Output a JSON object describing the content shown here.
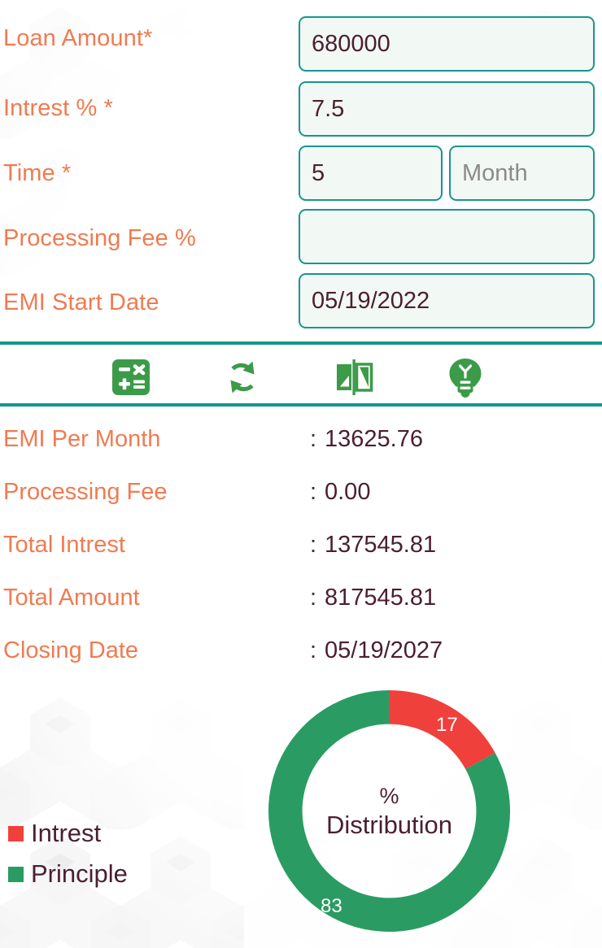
{
  "theme": {
    "label_color": "#ef7b52",
    "value_color": "#4a1f32",
    "accent_teal": "#17968f",
    "icon_green": "#3c9b49",
    "interest_red": "#f0403c",
    "principle_green": "#2a9c63",
    "field_bg": "#f2f8f4",
    "page_bg": "#ffffff"
  },
  "form": {
    "rows": [
      {
        "label": "Loan Amount*",
        "value": "680000",
        "placeholder": "",
        "name": "loan-amount"
      },
      {
        "label": "Intrest % *",
        "value": "7.5",
        "placeholder": "",
        "name": "interest-rate"
      },
      {
        "label": "Time *",
        "value": "5",
        "placeholder": "",
        "name": "time",
        "unit_value": "",
        "unit_placeholder": "Month"
      },
      {
        "label": "Processing Fee %",
        "value": "",
        "placeholder": "",
        "name": "processing-fee"
      },
      {
        "label": "EMI Start Date",
        "value": "05/19/2022",
        "placeholder": "",
        "name": "emi-start-date"
      }
    ]
  },
  "toolbar": {
    "buttons": [
      {
        "name": "calculate-button",
        "icon": "calculator-icon",
        "label": "Calculate"
      },
      {
        "name": "reset-button",
        "icon": "refresh-icon",
        "label": "Reset"
      },
      {
        "name": "compare-button",
        "icon": "compare-flip-icon",
        "label": "Compare"
      },
      {
        "name": "tips-button",
        "icon": "lightbulb-icon",
        "label": "Tips"
      }
    ]
  },
  "results": {
    "separator": ":",
    "rows": [
      {
        "label": "EMI Per Month",
        "value": "13625.76",
        "name": "emi-per-month"
      },
      {
        "label": "Processing Fee",
        "value": "0.00",
        "name": "processing-fee"
      },
      {
        "label": "Total Intrest",
        "value": "137545.81",
        "name": "total-interest"
      },
      {
        "label": "Total Amount",
        "value": "817545.81",
        "name": "total-amount"
      },
      {
        "label": "Closing Date",
        "value": "05/19/2027",
        "name": "closing-date"
      }
    ]
  },
  "chart_data": {
    "type": "pie",
    "title": "% Distribution",
    "center_line1": "%",
    "center_line2": "Distribution",
    "categories": [
      "Intrest",
      "Principle"
    ],
    "values": [
      17,
      83
    ],
    "value_labels": [
      "17",
      "83"
    ],
    "colors": [
      "#f0403c",
      "#2a9c63"
    ],
    "units": "percent",
    "donut": true,
    "inner_radius_ratio": 0.72,
    "start_angle_deg": 0,
    "legend_position": "bottom-left",
    "legend": [
      {
        "label": "Intrest",
        "color": "#f0403c"
      },
      {
        "label": "Principle",
        "color": "#2a9c63"
      }
    ]
  }
}
